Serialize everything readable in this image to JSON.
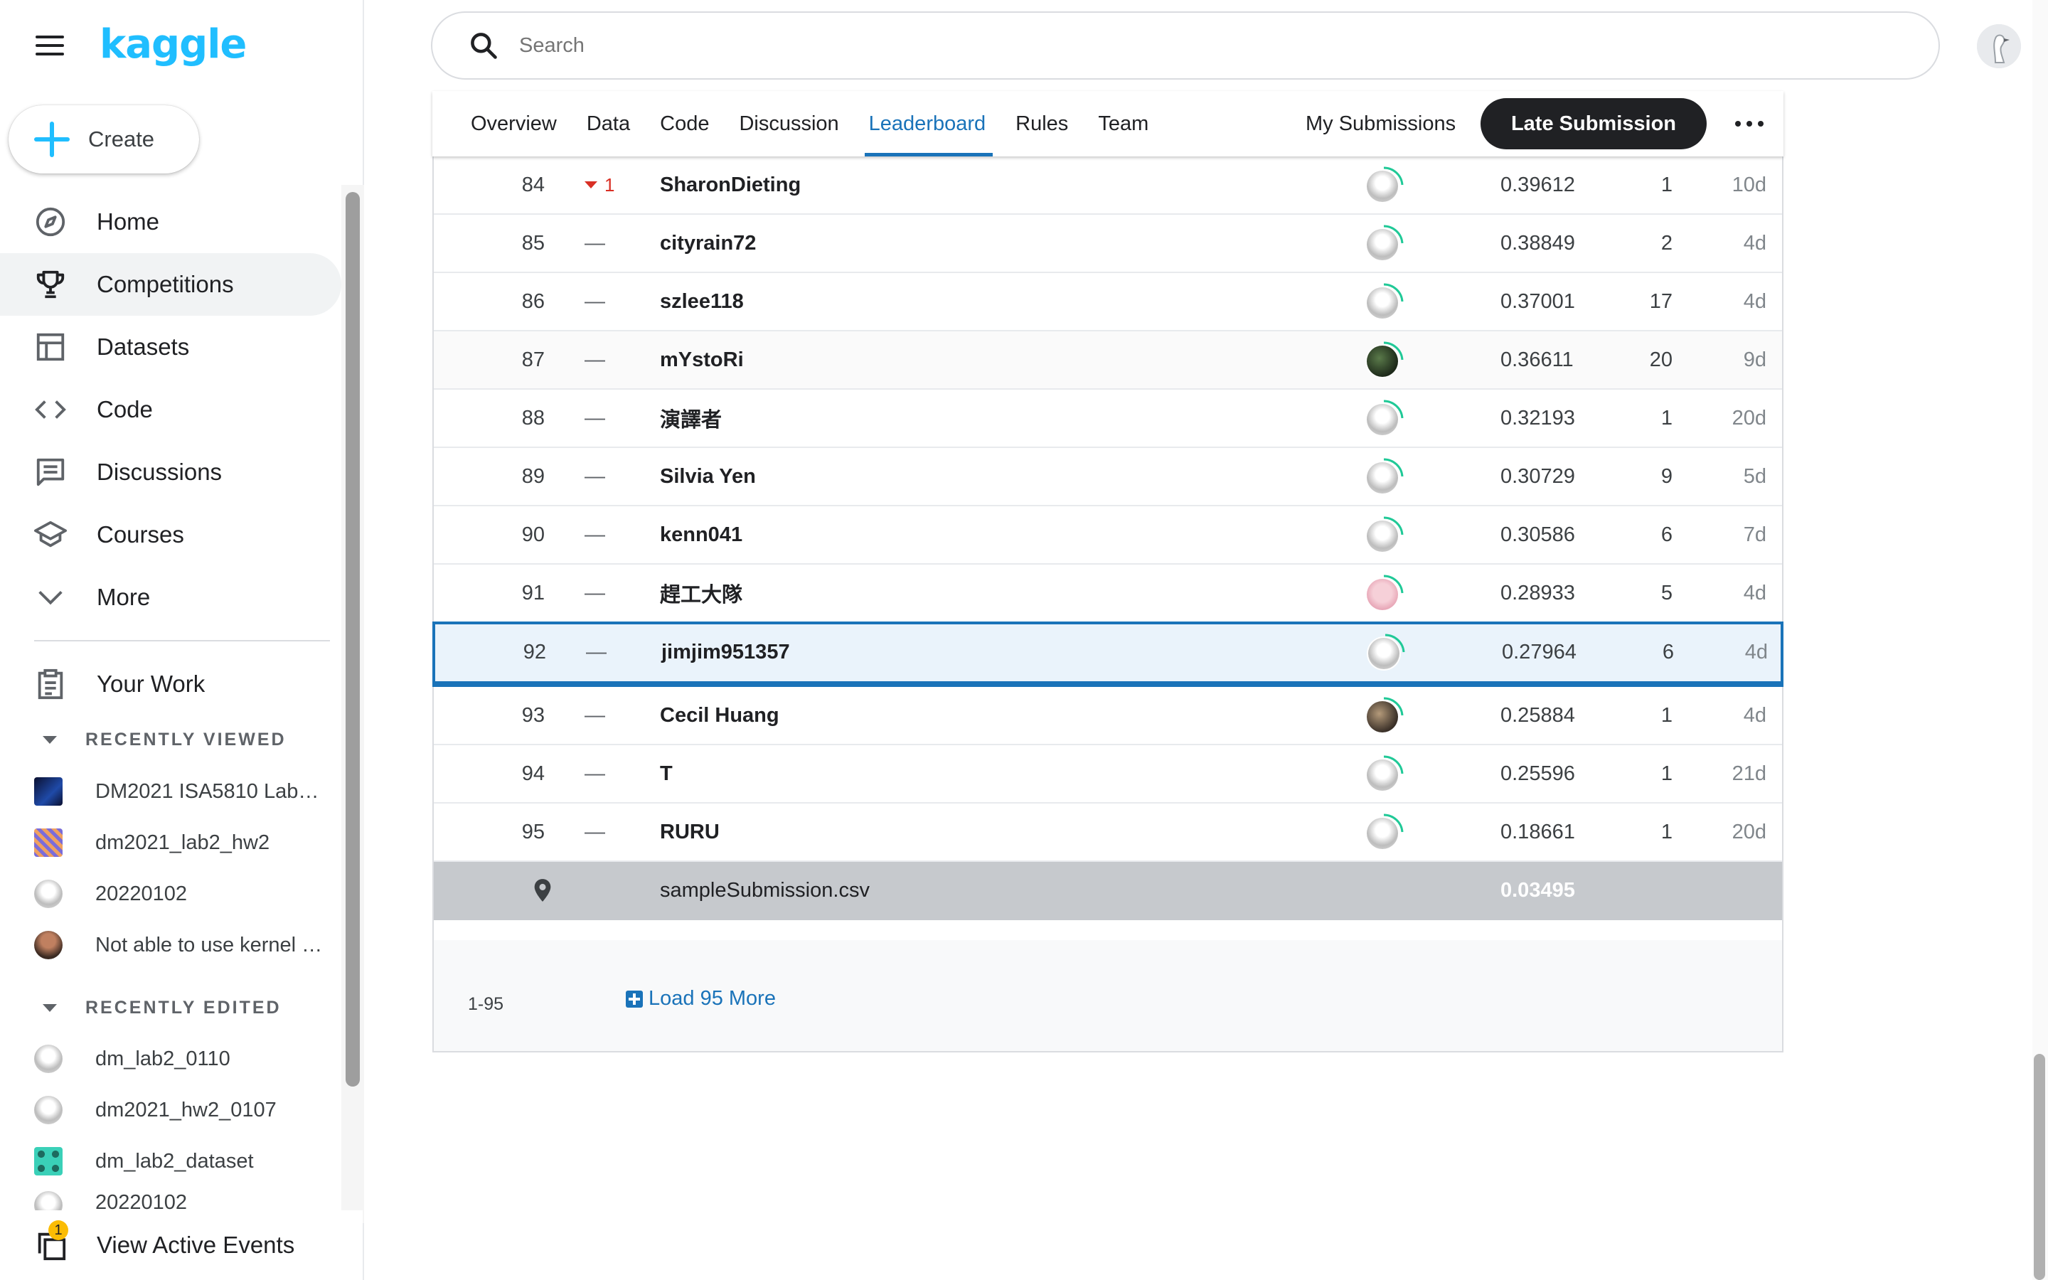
{
  "brand": {
    "logo": "kaggle",
    "accent": "#20beff"
  },
  "sidebar": {
    "create_label": "Create",
    "nav": [
      {
        "label": "Home",
        "icon": "compass-icon"
      },
      {
        "label": "Competitions",
        "icon": "trophy-icon",
        "active": true
      },
      {
        "label": "Datasets",
        "icon": "table-icon"
      },
      {
        "label": "Code",
        "icon": "code-icon"
      },
      {
        "label": "Discussions",
        "icon": "comments-icon"
      },
      {
        "label": "Courses",
        "icon": "school-icon"
      },
      {
        "label": "More",
        "icon": "chevron-down-icon"
      }
    ],
    "your_work": "Your Work",
    "recently_viewed_title": "RECENTLY VIEWED",
    "recently_viewed": [
      "DM2021 ISA5810 Lab2 Homework",
      "dm2021_lab2_hw2",
      "20220102",
      "Not able to use kernel with GPU"
    ],
    "recently_edited_title": "RECENTLY EDITED",
    "recently_edited": [
      "dm_lab2_0110",
      "dm2021_hw2_0107",
      "dm_lab2_dataset",
      "20220102"
    ],
    "events_label": "View Active Events",
    "events_badge": "1"
  },
  "search": {
    "placeholder": "Search"
  },
  "tabs": {
    "items": [
      "Overview",
      "Data",
      "Code",
      "Discussion",
      "Leaderboard",
      "Rules",
      "Team"
    ],
    "active": "Leaderboard",
    "my_submissions": "My Submissions",
    "late_submission": "Late Submission"
  },
  "leaderboard": {
    "rows": [
      {
        "rank": "84",
        "delta": "1",
        "delta_dir": "down",
        "team": "SharonDieting",
        "score": "0.39612",
        "entries": "1",
        "last": "10d"
      },
      {
        "rank": "85",
        "delta": "—",
        "team": "cityrain72",
        "score": "0.38849",
        "entries": "2",
        "last": "4d"
      },
      {
        "rank": "86",
        "delta": "—",
        "team": "szlee118",
        "score": "0.37001",
        "entries": "17",
        "last": "4d"
      },
      {
        "rank": "87",
        "delta": "—",
        "team": "mYstoRi",
        "score": "0.36611",
        "entries": "20",
        "last": "9d"
      },
      {
        "rank": "88",
        "delta": "—",
        "team": "演譯者",
        "score": "0.32193",
        "entries": "1",
        "last": "20d"
      },
      {
        "rank": "89",
        "delta": "—",
        "team": "Silvia Yen",
        "score": "0.30729",
        "entries": "9",
        "last": "5d"
      },
      {
        "rank": "90",
        "delta": "—",
        "team": "kenn041",
        "score": "0.30586",
        "entries": "6",
        "last": "7d"
      },
      {
        "rank": "91",
        "delta": "—",
        "team": "趕工大隊",
        "score": "0.28933",
        "entries": "5",
        "last": "4d"
      },
      {
        "rank": "92",
        "delta": "—",
        "team": "jimjim951357",
        "score": "0.27964",
        "entries": "6",
        "last": "4d",
        "me": true
      },
      {
        "rank": "93",
        "delta": "—",
        "team": "Cecil Huang",
        "score": "0.25884",
        "entries": "1",
        "last": "4d"
      },
      {
        "rank": "94",
        "delta": "—",
        "team": "T",
        "score": "0.25596",
        "entries": "1",
        "last": "21d"
      },
      {
        "rank": "95",
        "delta": "—",
        "team": "RURU",
        "score": "0.18661",
        "entries": "1",
        "last": "20d"
      }
    ],
    "benchmark": {
      "team": "sampleSubmission.csv",
      "score": "0.03495",
      "icon": "map-pin-icon"
    },
    "range": "1-95",
    "load_more": "Load 95 More"
  }
}
